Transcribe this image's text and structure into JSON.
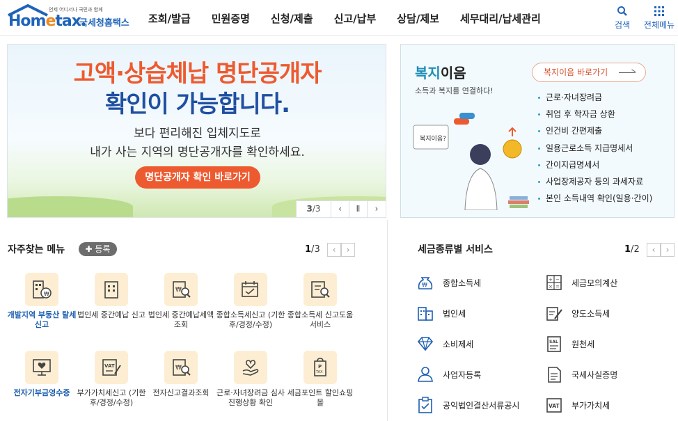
{
  "header": {
    "logo_sub": "언제 어디서나 국민과 함께",
    "logo_home": "Hom",
    "logo_e": "e",
    "logo_tax": "tax.",
    "logo_org": "국세청홈택스",
    "nav": [
      "조회/발급",
      "민원증명",
      "신청/제출",
      "신고/납부",
      "상담/제보",
      "세무대리/납세관리"
    ],
    "search_label": "검색",
    "allmenu_label": "전체메뉴"
  },
  "banner": {
    "line1": "고액·상습체납 명단공개자",
    "line2": "확인이 가능합니다.",
    "desc1": "보다 편리해진 입체지도로",
    "desc2": "내가 사는 지역의 명단공개자를 확인하세요.",
    "cta": "명단공개자 확인 바로가기",
    "page_current": "3",
    "page_total": "3",
    "page_sep": "/",
    "prev": "‹",
    "pause": "Ⅱ",
    "next": "›"
  },
  "welfare": {
    "title_a": "복지",
    "title_b": "이음",
    "subtitle": "소득과 복지를 연결하다!",
    "link": "복지이음 바로가기",
    "speech": "복지이음?",
    "items": [
      "근로·자녀장려금",
      "취업 후 학자금 상환",
      "인건비 간편제출",
      "일용근로소득 지급명세서",
      "간이지급명세서",
      "사업장제공자 등의 과세자료",
      "본인 소득내역 확인(일용·간이)"
    ]
  },
  "favorites": {
    "title": "자주찾는 메뉴",
    "add_label": "등록",
    "page_current": "1",
    "page_total": "3",
    "page_sep": "/",
    "items": [
      {
        "label": "개발지역 부동산 탈세신고",
        "icon": "building-money-icon",
        "highlight": true
      },
      {
        "label": "법인세 중간예납 신고",
        "icon": "office-building-icon",
        "highlight": false
      },
      {
        "label": "법인세 중간예납세액 조회",
        "icon": "document-search-icon",
        "highlight": false
      },
      {
        "label": "종합소득세신고 (기한후/경정/수정)",
        "icon": "calendar-check-icon",
        "highlight": false
      },
      {
        "label": "종합소득세 신고도움 서비스",
        "icon": "document-magnifier-icon",
        "highlight": false
      },
      {
        "label": "전자기부금영수증",
        "icon": "heart-monitor-icon",
        "highlight": true
      },
      {
        "label": "부가가치세신고 (기한후/경정/수정)",
        "icon": "vat-document-icon",
        "highlight": false
      },
      {
        "label": "전자신고결과조회",
        "icon": "won-search-icon",
        "highlight": false
      },
      {
        "label": "근로·자녀장려금 심사진행상황 확인",
        "icon": "heart-hand-icon",
        "highlight": false
      },
      {
        "label": "세금포인트 할인쇼핑몰",
        "icon": "tax-bag-icon",
        "highlight": false
      }
    ]
  },
  "taxservice": {
    "title": "세금종류별 서비스",
    "page_current": "1",
    "page_total": "2",
    "page_sep": "/",
    "items": [
      {
        "label": "종합소득세",
        "icon": "money-bag-icon"
      },
      {
        "label": "세금모의계산",
        "icon": "calculator-icon"
      },
      {
        "label": "법인세",
        "icon": "building-icon"
      },
      {
        "label": "양도소득세",
        "icon": "document-edit-icon"
      },
      {
        "label": "소비제세",
        "icon": "diamond-icon"
      },
      {
        "label": "원천세",
        "icon": "salary-document-icon"
      },
      {
        "label": "사업자등록",
        "icon": "user-register-icon"
      },
      {
        "label": "국세사실증명",
        "icon": "certificate-icon"
      },
      {
        "label": "공익법인결산서류공시",
        "icon": "clipboard-icon"
      },
      {
        "label": "부가가치세",
        "icon": "vat-icon"
      }
    ]
  },
  "colors": {
    "brand": "#1d63b9",
    "accent": "#ee5a2f",
    "welfare": "#1f8eb6",
    "orange": "#f08a1d"
  }
}
